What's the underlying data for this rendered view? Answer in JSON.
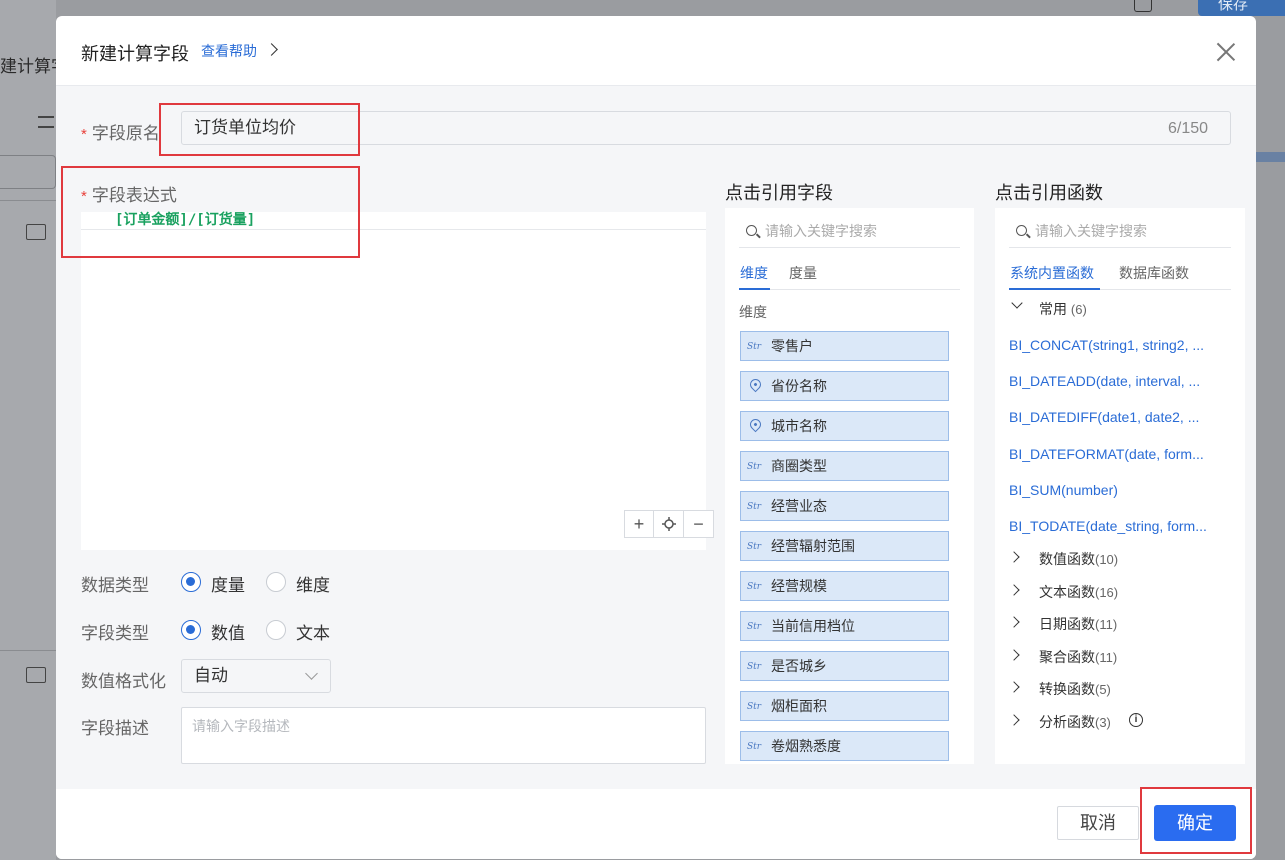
{
  "background": {
    "left_title": "建计算字",
    "save_button": "保存"
  },
  "dialog": {
    "title": "新建计算字段",
    "help_link": "查看帮助",
    "field_name": {
      "label": "字段原名",
      "value": "订货单位均价",
      "count": "6/150"
    },
    "expression": {
      "label": "字段表达式",
      "code": "[订单金额]/[订货量]",
      "zoom_in": "+",
      "zoom_out": "−"
    },
    "data_type": {
      "label": "数据类型",
      "options": [
        "度量",
        "维度"
      ],
      "selected": "度量"
    },
    "field_type": {
      "label": "字段类型",
      "options": [
        "数值",
        "文本"
      ],
      "selected": "数值"
    },
    "number_format": {
      "label": "数值格式化",
      "value": "自动"
    },
    "description": {
      "label": "字段描述",
      "placeholder": "请输入字段描述"
    },
    "fields_panel": {
      "title": "点击引用字段",
      "search_placeholder": "请输入关键字搜索",
      "tabs": [
        "维度",
        "度量"
      ],
      "active_tab": "维度",
      "section": "维度",
      "items": [
        {
          "type": "Str",
          "icon": "string-icon",
          "label": "零售户"
        },
        {
          "type": "geo",
          "icon": "location-pin-icon",
          "label": "省份名称"
        },
        {
          "type": "geo",
          "icon": "location-pin-icon",
          "label": "城市名称"
        },
        {
          "type": "Str",
          "icon": "string-icon",
          "label": "商圈类型"
        },
        {
          "type": "Str",
          "icon": "string-icon",
          "label": "经营业态"
        },
        {
          "type": "Str",
          "icon": "string-icon",
          "label": "经营辐射范围"
        },
        {
          "type": "Str",
          "icon": "string-icon",
          "label": "经营规模"
        },
        {
          "type": "Str",
          "icon": "string-icon",
          "label": "当前信用档位"
        },
        {
          "type": "Str",
          "icon": "string-icon",
          "label": "是否城乡"
        },
        {
          "type": "Str",
          "icon": "string-icon",
          "label": "烟柜面积"
        },
        {
          "type": "Str",
          "icon": "string-icon",
          "label": "卷烟熟悉度"
        }
      ]
    },
    "functions_panel": {
      "title": "点击引用函数",
      "search_placeholder": "请输入关键字搜索",
      "tabs": [
        "系统内置函数",
        "数据库函数"
      ],
      "active_tab": "系统内置函数",
      "common_group": {
        "label": "常用",
        "count": "(6)"
      },
      "common_items": [
        "BI_CONCAT(string1, string2, ...",
        "BI_DATEADD(date, interval, ...",
        "BI_DATEDIFF(date1, date2, ...",
        "BI_DATEFORMAT(date, form...",
        "BI_SUM(number)",
        "BI_TODATE(date_string, form..."
      ],
      "groups": [
        {
          "label": "数值函数",
          "count": "(10)"
        },
        {
          "label": "文本函数",
          "count": "(16)"
        },
        {
          "label": "日期函数",
          "count": "(11)"
        },
        {
          "label": "聚合函数",
          "count": "(11)"
        },
        {
          "label": "转换函数",
          "count": "(5)"
        },
        {
          "label": "分析函数",
          "count": "(3)"
        }
      ]
    },
    "footer": {
      "cancel": "取消",
      "ok": "确定"
    }
  },
  "colors": {
    "accent": "#2a6cf0",
    "link": "#2a6cd6",
    "highlight_box": "#e0393e",
    "expression_code": "#19a15f",
    "field_chip_bg": "#dbe8f8"
  }
}
